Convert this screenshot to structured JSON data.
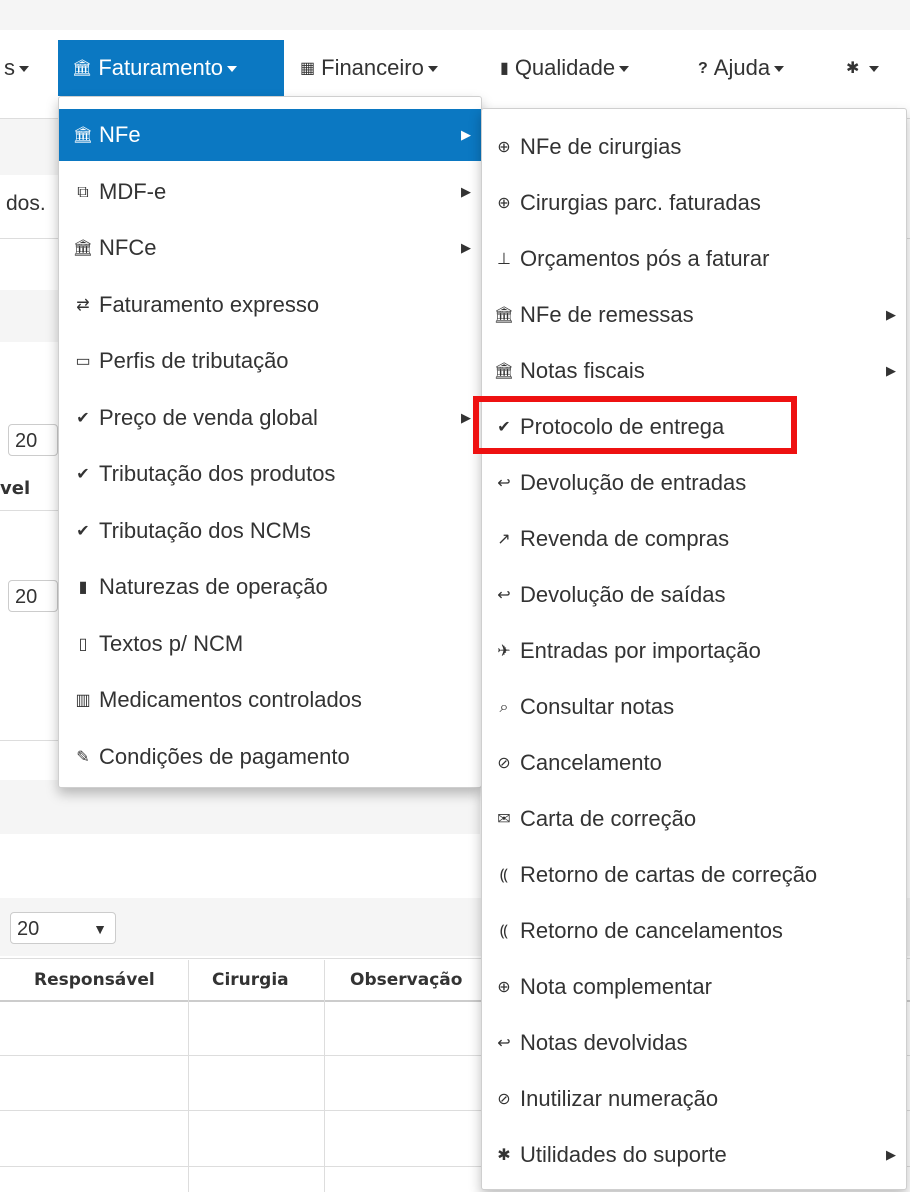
{
  "navbar": {
    "items": [
      {
        "label": "s",
        "icon": "",
        "active": false
      },
      {
        "label": "Faturamento",
        "icon": "bank-icon",
        "active": true
      },
      {
        "label": "Financeiro",
        "icon": "table-icon",
        "active": false
      },
      {
        "label": "Qualidade",
        "icon": "book-icon",
        "active": false
      },
      {
        "label": "Ajuda",
        "icon": "question-icon",
        "active": false
      },
      {
        "label": "",
        "icon": "gear-icon",
        "active": false
      }
    ],
    "icons": {
      "bank": "🏛",
      "table": "▦",
      "book": "▮",
      "question": "?",
      "gear": "✱"
    }
  },
  "background": {
    "text_dos": "dos.",
    "text_vel": "vel",
    "select1": "20",
    "select2": "20",
    "select3": "20",
    "table_headers": [
      "Responsável",
      "Cirurgia",
      "Observação"
    ]
  },
  "faturamento_menu": {
    "items": [
      {
        "label": "NFe",
        "icon": "bank-icon",
        "glyph": "🏛",
        "submenu": true,
        "active": true
      },
      {
        "label": "MDF-e",
        "icon": "copy-icon",
        "glyph": "⧉",
        "submenu": true,
        "active": false
      },
      {
        "label": "NFCe",
        "icon": "bank-icon",
        "glyph": "🏛",
        "submenu": true,
        "active": false
      },
      {
        "label": "Faturamento expresso",
        "icon": "exchange-icon",
        "glyph": "⇄",
        "submenu": false,
        "active": false
      },
      {
        "label": "Perfis de tributação",
        "icon": "scroll-icon",
        "glyph": "▭",
        "submenu": false,
        "active": false
      },
      {
        "label": "Preço de venda global",
        "icon": "check-icon",
        "glyph": "✔",
        "submenu": true,
        "active": false
      },
      {
        "label": "Tributação dos produtos",
        "icon": "check-icon",
        "glyph": "✔",
        "submenu": false,
        "active": false
      },
      {
        "label": "Tributação dos NCMs",
        "icon": "check-icon",
        "glyph": "✔",
        "submenu": false,
        "active": false
      },
      {
        "label": "Naturezas de operação",
        "icon": "book-icon",
        "glyph": "▮",
        "submenu": false,
        "active": false
      },
      {
        "label": "Textos p/ NCM",
        "icon": "clipboard-icon",
        "glyph": "▯",
        "submenu": false,
        "active": false
      },
      {
        "label": "Medicamentos controlados",
        "icon": "medical-book-icon",
        "glyph": "▥",
        "submenu": false,
        "active": false
      },
      {
        "label": "Condições de pagamento",
        "icon": "pencil-icon",
        "glyph": "✎",
        "submenu": false,
        "active": false
      }
    ]
  },
  "nfe_submenu": {
    "items": [
      {
        "label": "NFe de cirurgias",
        "icon": "plus-circle-icon",
        "glyph": "⊕",
        "submenu": false
      },
      {
        "label": "Cirurgias parc. faturadas",
        "icon": "plus-circle-icon",
        "glyph": "⊕",
        "submenu": false
      },
      {
        "label": "Orçamentos pós a faturar",
        "icon": "pin-icon",
        "glyph": "⊥",
        "submenu": false
      },
      {
        "label": "NFe de remessas",
        "icon": "bank-icon",
        "glyph": "🏛",
        "submenu": true
      },
      {
        "label": "Notas fiscais",
        "icon": "bank-icon",
        "glyph": "🏛",
        "submenu": true
      },
      {
        "label": "Protocolo de entrega",
        "icon": "check-icon",
        "glyph": "✔",
        "submenu": false,
        "highlighted": true
      },
      {
        "label": "Devolução de entradas",
        "icon": "return-icon",
        "glyph": "↩",
        "submenu": false
      },
      {
        "label": "Revenda de compras",
        "icon": "arrow-up-right-icon",
        "glyph": "↗",
        "submenu": false
      },
      {
        "label": "Devolução de saídas",
        "icon": "return-icon",
        "glyph": "↩",
        "submenu": false
      },
      {
        "label": "Entradas por importação",
        "icon": "plane-icon",
        "glyph": "✈",
        "submenu": false
      },
      {
        "label": "Consultar notas",
        "icon": "search-icon",
        "glyph": "⌕",
        "submenu": false
      },
      {
        "label": "Cancelamento",
        "icon": "ban-icon",
        "glyph": "⊘",
        "submenu": false
      },
      {
        "label": "Carta de correção",
        "icon": "envelope-icon",
        "glyph": "✉",
        "submenu": false
      },
      {
        "label": "Retorno de cartas de correção",
        "icon": "rss-icon",
        "glyph": "⸨",
        "submenu": false
      },
      {
        "label": "Retorno de cancelamentos",
        "icon": "rss-icon",
        "glyph": "⸨",
        "submenu": false
      },
      {
        "label": "Nota complementar",
        "icon": "plus-circle-icon",
        "glyph": "⊕",
        "submenu": false
      },
      {
        "label": "Notas devolvidas",
        "icon": "return-icon",
        "glyph": "↩",
        "submenu": false
      },
      {
        "label": "Inutilizar numeração",
        "icon": "ban-icon",
        "glyph": "⊘",
        "submenu": false
      },
      {
        "label": "Utilidades do suporte",
        "icon": "gear-icon",
        "glyph": "✱",
        "submenu": true
      }
    ]
  },
  "colors": {
    "active": "#0b78c2",
    "highlight": "#ee1111"
  }
}
